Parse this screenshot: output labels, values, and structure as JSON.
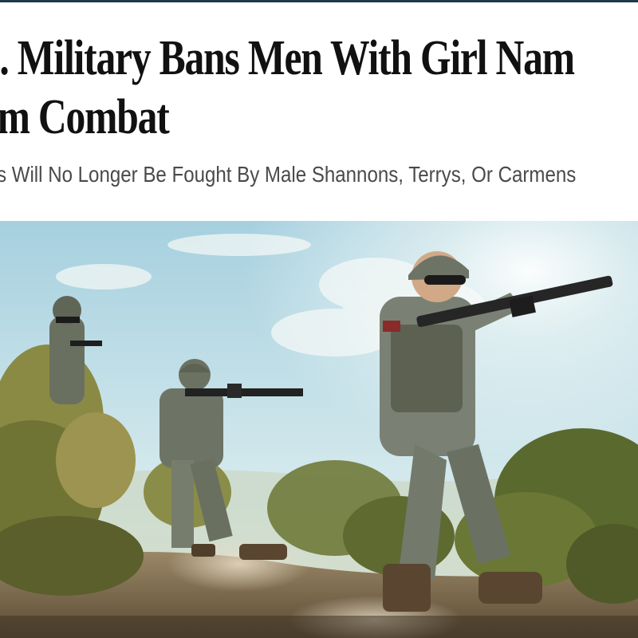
{
  "article": {
    "headline_line1": "S. Military Bans Men With Girl Nam",
    "headline_line2": "om Combat",
    "subheadline": "s Will No Longer Be Fought By Male Shannons, Terrys, Or Carmens"
  },
  "photo": {
    "subject": "soldiers-advancing-with-rifles",
    "colors": {
      "sky_top": "#a9d2e0",
      "sky_bottom": "#dcecef",
      "ground": "#7a6a4e",
      "brush": "#6f7a3a",
      "camo": "#6d7466"
    }
  }
}
